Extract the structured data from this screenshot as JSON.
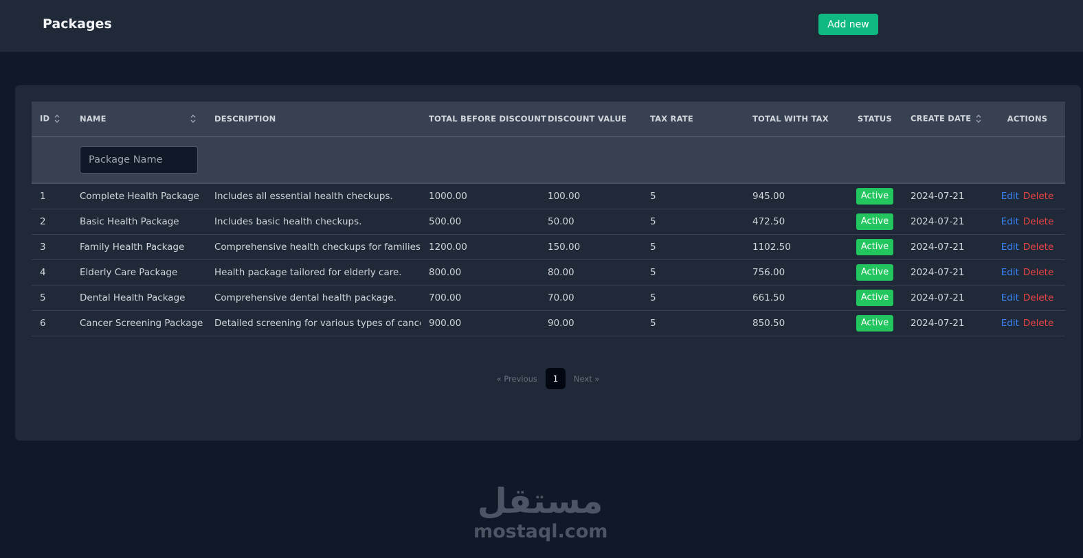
{
  "header": {
    "title": "Packages",
    "add_label": "Add new"
  },
  "table": {
    "columns": {
      "id": "ID",
      "name": "NAME",
      "description": "DESCRIPTION",
      "total_before_discount": "TOTAL BEFORE DISCOUNT",
      "discount_value": "DISCOUNT VALUE",
      "tax_rate": "TAX RATE",
      "total_with_tax": "TOTAL WITH TAX",
      "status": "STATUS",
      "create_date": "CREATE DATE",
      "actions": "ACTIONS"
    },
    "filter": {
      "name_placeholder": "Package Name"
    },
    "rows": [
      {
        "id": "1",
        "name": "Complete Health Package",
        "description": "Includes all essential health checkups.",
        "total": "1000.00",
        "discount": "100.00",
        "tax": "5",
        "total_tax": "945.00",
        "status": "Active",
        "date": "2024-07-21",
        "edit": "Edit",
        "delete": "Delete"
      },
      {
        "id": "2",
        "name": "Basic Health Package",
        "description": "Includes basic health checkups.",
        "total": "500.00",
        "discount": "50.00",
        "tax": "5",
        "total_tax": "472.50",
        "status": "Active",
        "date": "2024-07-21",
        "edit": "Edit",
        "delete": "Delete"
      },
      {
        "id": "3",
        "name": "Family Health Package",
        "description": "Comprehensive health checkups for families.",
        "total": "1200.00",
        "discount": "150.00",
        "tax": "5",
        "total_tax": "1102.50",
        "status": "Active",
        "date": "2024-07-21",
        "edit": "Edit",
        "delete": "Delete"
      },
      {
        "id": "4",
        "name": "Elderly Care Package",
        "description": "Health package tailored for elderly care.",
        "total": "800.00",
        "discount": "80.00",
        "tax": "5",
        "total_tax": "756.00",
        "status": "Active",
        "date": "2024-07-21",
        "edit": "Edit",
        "delete": "Delete"
      },
      {
        "id": "5",
        "name": "Dental Health Package",
        "description": "Comprehensive dental health package.",
        "total": "700.00",
        "discount": "70.00",
        "tax": "5",
        "total_tax": "661.50",
        "status": "Active",
        "date": "2024-07-21",
        "edit": "Edit",
        "delete": "Delete"
      },
      {
        "id": "6",
        "name": "Cancer Screening Package",
        "description": "Detailed screening for various types of cancer.",
        "total": "900.00",
        "discount": "90.00",
        "tax": "5",
        "total_tax": "850.50",
        "status": "Active",
        "date": "2024-07-21",
        "edit": "Edit",
        "delete": "Delete"
      }
    ]
  },
  "pagination": {
    "previous": "« Previous",
    "current": "1",
    "next": "Next »"
  },
  "watermark": {
    "arabic": "مستقل",
    "latin": "mostaql.com"
  },
  "colors": {
    "background": "#111827",
    "surface": "#1f2937",
    "header_row": "#374151",
    "accent_add": "#10b981",
    "badge_active": "#22c55e",
    "edit_link": "#3b82f6",
    "delete_link": "#ef4444"
  },
  "icons": {
    "sort": "sort-updown-icon"
  }
}
